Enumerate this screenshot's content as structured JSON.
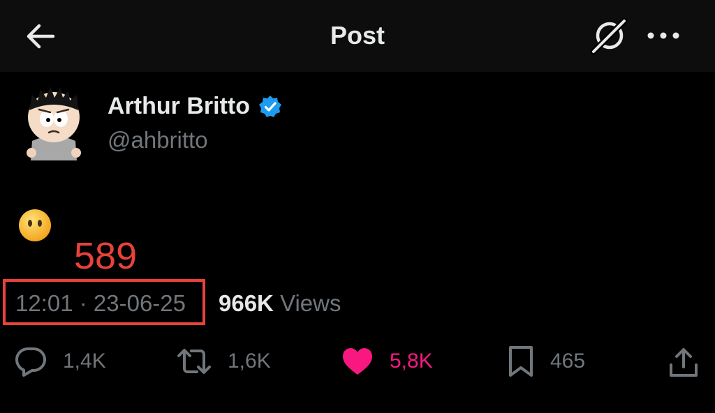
{
  "header": {
    "title": "Post",
    "back_icon": "arrow-left-icon",
    "grok_icon": "grok-icon",
    "more_icon": "more-dots-icon"
  },
  "author": {
    "display_name": "Arthur Britto",
    "handle": "@ahbritto",
    "verified": true,
    "verified_color": "#1d9bf0"
  },
  "post": {
    "content_emoji": "😶",
    "timestamp": "12:01 · 23-06-25",
    "views_count": "966K",
    "views_label": "Views"
  },
  "annotation": {
    "text": "589",
    "color": "#e8423a"
  },
  "actions": {
    "replies": "1,4K",
    "reposts": "1,6K",
    "likes": "5,8K",
    "liked": true,
    "like_color": "#f91880",
    "bookmarks": "465"
  }
}
